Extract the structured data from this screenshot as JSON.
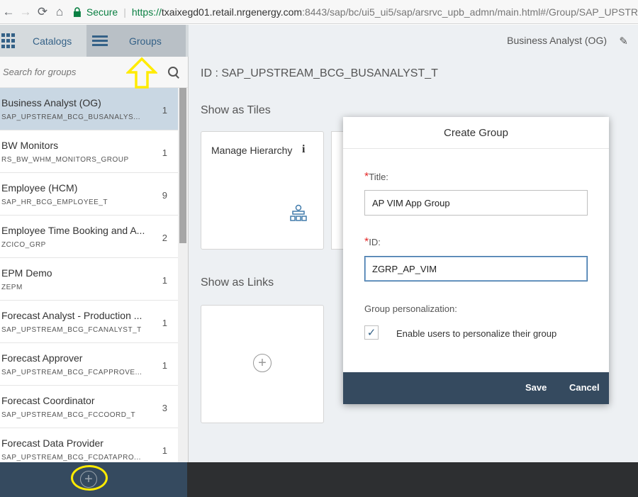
{
  "browser": {
    "back": "←",
    "forward": "→",
    "reload": "⟳",
    "home": "⌂",
    "secure_label": "Secure",
    "separator": "|",
    "url_scheme": "https://",
    "url_host": "txaixegd01.retail.nrgenergy.com",
    "url_rest": ":8443/sap/bc/ui5_ui5/sap/arsrvc_upb_admn/main.html#/Group/SAP_UPSTR"
  },
  "header": {
    "catalogs_label": "Catalogs",
    "groups_label": "Groups",
    "role_title": "Business Analyst (OG)",
    "edit_icon": "✎"
  },
  "sidebar": {
    "search_placeholder": "Search for groups",
    "groups": [
      {
        "title": "Business Analyst (OG)",
        "id": "SAP_UPSTREAM_BCG_BUSANALYS...",
        "count": "1"
      },
      {
        "title": "BW Monitors",
        "id": "RS_BW_WHM_MONITORS_GROUP",
        "count": "1"
      },
      {
        "title": "Employee (HCM)",
        "id": "SAP_HR_BCG_EMPLOYEE_T",
        "count": "9"
      },
      {
        "title": "Employee Time Booking and A...",
        "id": "ZCICO_GRP",
        "count": "2"
      },
      {
        "title": "EPM Demo",
        "id": "ZEPM",
        "count": "1"
      },
      {
        "title": "Forecast Analyst - Production ...",
        "id": "SAP_UPSTREAM_BCG_FCANALYST_T",
        "count": "1"
      },
      {
        "title": "Forecast Approver",
        "id": "SAP_UPSTREAM_BCG_FCAPPROVE...",
        "count": "1"
      },
      {
        "title": "Forecast Coordinator",
        "id": "SAP_UPSTREAM_BCG_FCCOORD_T",
        "count": "3"
      },
      {
        "title": "Forecast Data Provider",
        "id": "SAP_UPSTREAM_BCG_FCDATAPRO...",
        "count": "1"
      }
    ],
    "add_symbol": "+"
  },
  "main": {
    "id_label": "ID : SAP_UPSTREAM_BCG_BUSANALYST_T",
    "tiles_header": "Show as Tiles",
    "tile_title": "Manage Hierarchy",
    "info_symbol": "i",
    "links_header": "Show as Links",
    "add_symbol": "+"
  },
  "dialog": {
    "title": "Create Group",
    "required_mark": "*",
    "title_label": "Title:",
    "title_value": "AP VIM App Group",
    "id_label": "ID:",
    "id_value": "ZGRP_AP_VIM",
    "personalization_label": "Group personalization:",
    "checkbox_mark": "✓",
    "checkbox_label": "Enable users to personalize their group",
    "save_label": "Save",
    "cancel_label": "Cancel"
  },
  "colors": {
    "accent": "#346187",
    "selected_row": "#c9d7e3",
    "footer": "#354a5f",
    "annotation": "#ffeb00"
  }
}
